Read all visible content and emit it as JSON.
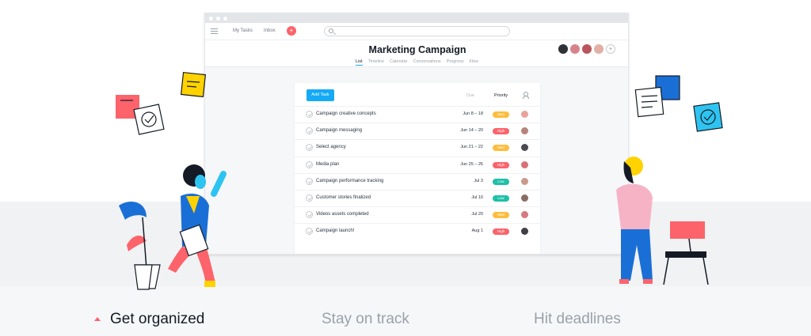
{
  "colors": {
    "accent": "#14aaf5",
    "high": "#fc636b",
    "med": "#fdbd3c",
    "low": "#1ec0a8",
    "active_caret": "#fc636b"
  },
  "topbar": {
    "my_tasks": "My Tasks",
    "inbox": "Inbox",
    "search_placeholder": ""
  },
  "project": {
    "title": "Marketing Campaign",
    "tabs": [
      "List",
      "Timeline",
      "Calendar",
      "Conversations",
      "Progress",
      "Files"
    ],
    "active_tab": "List"
  },
  "task_list": {
    "add_task_label": "Add Task",
    "col_due": "Due",
    "col_priority": "Priority",
    "rows": [
      {
        "name": "Campaign creative concepts",
        "due": "Jun 8 – 18",
        "priority": "Med",
        "priority_color": "#fdbd3c",
        "avatar": "#e9a39a"
      },
      {
        "name": "Campaign messaging",
        "due": "Jun 14 – 20",
        "priority": "High",
        "priority_color": "#fc636b",
        "avatar": "#b7847a"
      },
      {
        "name": "Select agency",
        "due": "Jun 21 – 22",
        "priority": "Med",
        "priority_color": "#fdbd3c",
        "avatar": "#4a4a52"
      },
      {
        "name": "Media plan",
        "due": "Jun 25 – 26",
        "priority": "High",
        "priority_color": "#fc636b",
        "avatar": "#d96f77"
      },
      {
        "name": "Campaign performance tracking",
        "due": "Jul 3",
        "priority": "Low",
        "priority_color": "#1ec0a8",
        "avatar": "#c99a8c"
      },
      {
        "name": "Customer stories finalized",
        "due": "Jul 10",
        "priority": "Low",
        "priority_color": "#1ec0a8",
        "avatar": "#8b6c62"
      },
      {
        "name": "Videos assets completed",
        "due": "Jul 20",
        "priority": "Med",
        "priority_color": "#fdbd3c",
        "avatar": "#d7777e"
      },
      {
        "name": "Campaign launch!",
        "due": "Aug 1",
        "priority": "High",
        "priority_color": "#fc636b",
        "avatar": "#3f3f48"
      }
    ]
  },
  "features": {
    "one": "Get organized",
    "two": "Stay on track",
    "three": "Hit deadlines"
  }
}
